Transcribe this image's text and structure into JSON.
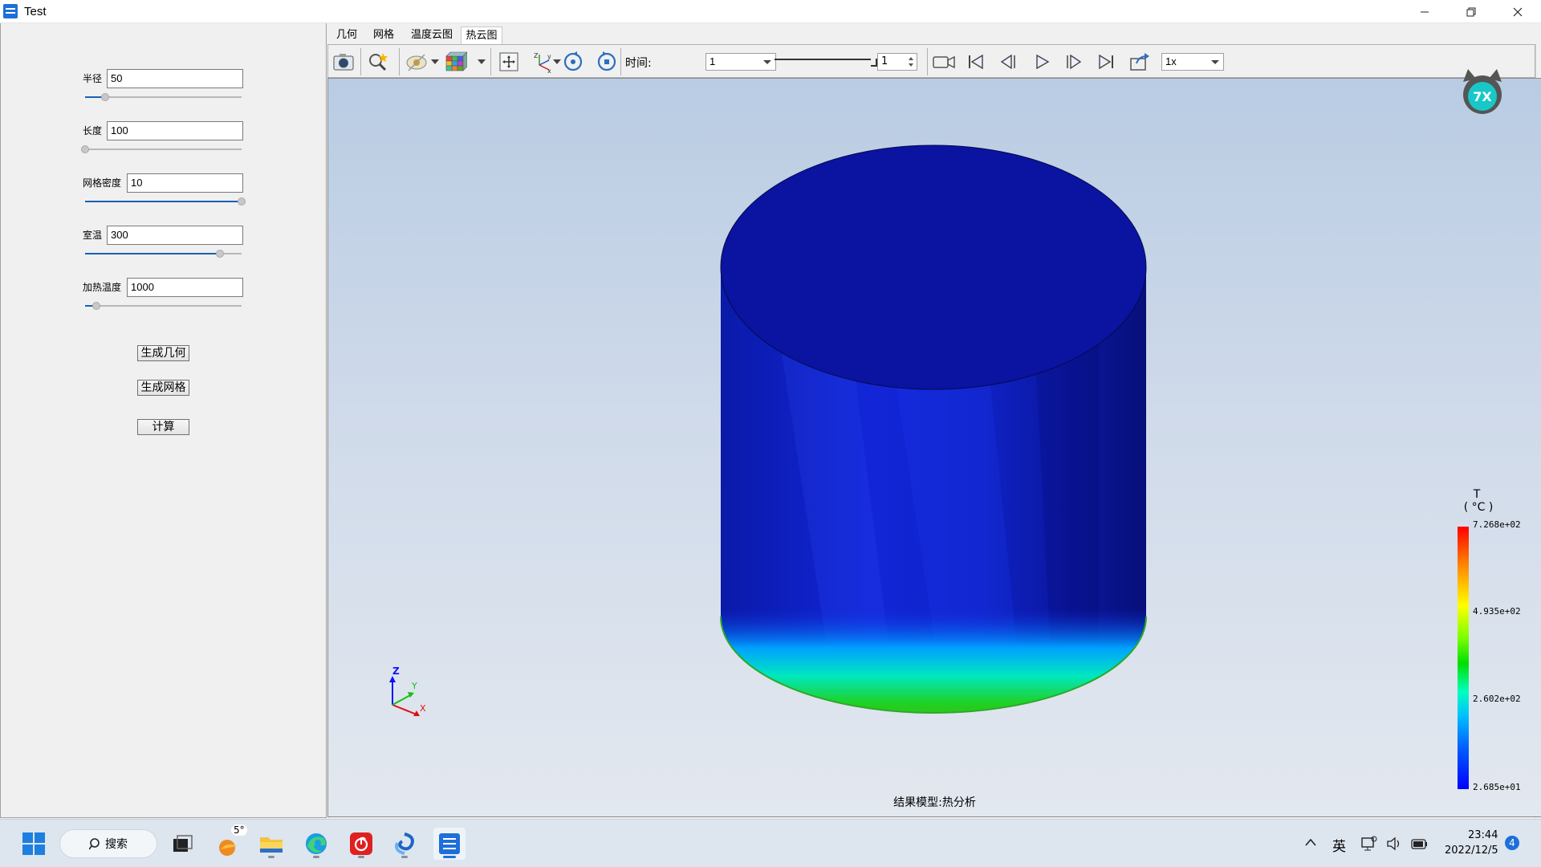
{
  "window": {
    "title": "Test",
    "controls": [
      "—",
      "❐",
      "✕"
    ]
  },
  "params": [
    {
      "label": "半径",
      "value": "50",
      "fraction": 0.13
    },
    {
      "label": "长度",
      "value": "100",
      "fraction": 0.0
    },
    {
      "label": "网格密度",
      "value": "10",
      "fraction": 1.0
    },
    {
      "label": "室温",
      "value": "300",
      "fraction": 0.86
    },
    {
      "label": "加热温度",
      "value": "1000",
      "fraction": 0.07
    }
  ],
  "buttons": {
    "geometry": "生成几何",
    "mesh": "生成网格",
    "compute": "计算"
  },
  "tabs": [
    "几何",
    "网格",
    "温度云图",
    "热云图"
  ],
  "active_tab": 3,
  "toolbar": {
    "time_label": "时间:",
    "time_value": "1",
    "step_value": "1",
    "speed_value": "1x"
  },
  "viewport": {
    "status": "结果模型:热分析",
    "axes": {
      "x": "X",
      "y": "Y",
      "z": "Z"
    },
    "legend": {
      "title_line1": "T",
      "title_line2": "( °C )",
      "labels": [
        "7.268e+02",
        "4.935e+02",
        "2.602e+02",
        "2.685e+01"
      ]
    }
  },
  "taskbar": {
    "search_label": "搜索",
    "weather": "5°",
    "ime": "英",
    "time": "23:44",
    "date": "2022/12/5",
    "notifications": "4"
  }
}
